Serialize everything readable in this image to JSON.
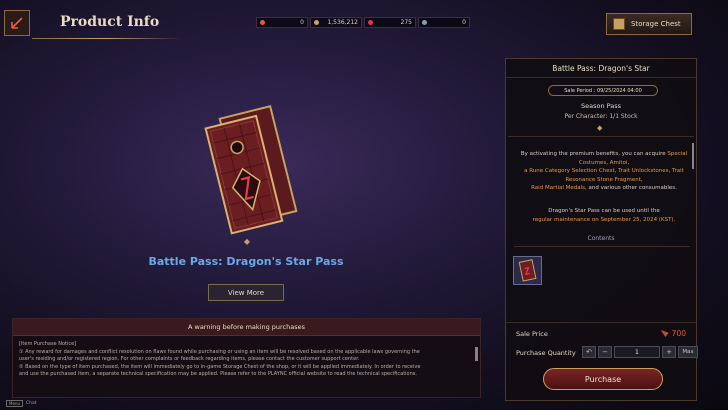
{
  "header": {
    "title": "Product Info",
    "storage_label": "Storage Chest"
  },
  "currencies": [
    {
      "icon": "arrow-currency-icon",
      "value": "0",
      "color": "#e8583a"
    },
    {
      "icon": "gold-coin-icon",
      "value": "1,536,212",
      "color": "#c9a060"
    },
    {
      "icon": "red-gem-icon",
      "value": "275",
      "color": "#e8304a"
    },
    {
      "icon": "silver-orb-icon",
      "value": "0",
      "color": "#8a9ab8"
    }
  ],
  "product": {
    "name": "Battle Pass: Dragon's Star Pass",
    "view_more": "View More"
  },
  "notice": {
    "header": "A warning before making purchases",
    "lines": [
      "[Item Purchase Notice]",
      "① Any reward for damages and conflict resolution on flaws found while purchasing or using an item will be resolved based on the applicable laws governing the",
      "user's residing and/or registered region. For other complaints or feedback regarding items, please contact the customer support center.",
      "② Based on the type of item purchased, the item will immediately go to in-game Storage Chest of the shop, or it will be applied immediately. In order to receive",
      "and use the purchased item, a separate technical specification may be applied. Please refer to the PLAYNC official website to read the technical specifications."
    ]
  },
  "panel": {
    "title": "Battle Pass: Dragon's Star",
    "sale_period": "Sale Period : 09/25/2024 04:00",
    "pass_type": "Season Pass",
    "per_character": "Per Character:   1/1 Stock",
    "desc_1a": "By activating the premium benefits, you can acquire ",
    "desc_1b": "Special Costumes",
    "desc_1c": ", ",
    "desc_1d": "Amitoi",
    "desc_1e": ",",
    "desc_1f": "a Rune Category Selection Chest",
    "desc_1g": ", ",
    "desc_1h": "Trait Unlockstones",
    "desc_1i": ", ",
    "desc_1j": "Trait Resonance Stone Fragment",
    "desc_1k": ",",
    "desc_1l": "Raid Martial Medals",
    "desc_1m": ", and various other consumables.",
    "desc_2a": "Dragon's Star Pass can be used until the",
    "desc_2b": "regular maintenance on September 25, 2024 (KST).",
    "contents_label": "Contents",
    "sale_price_label": "Sale Price",
    "sale_price": "700",
    "qty_label": "Purchase Quantity",
    "qty_value": "1",
    "max_label": "Max"
  },
  "purchase_label": "Purchase",
  "help": {
    "key": "Menu",
    "label": "Chat"
  }
}
